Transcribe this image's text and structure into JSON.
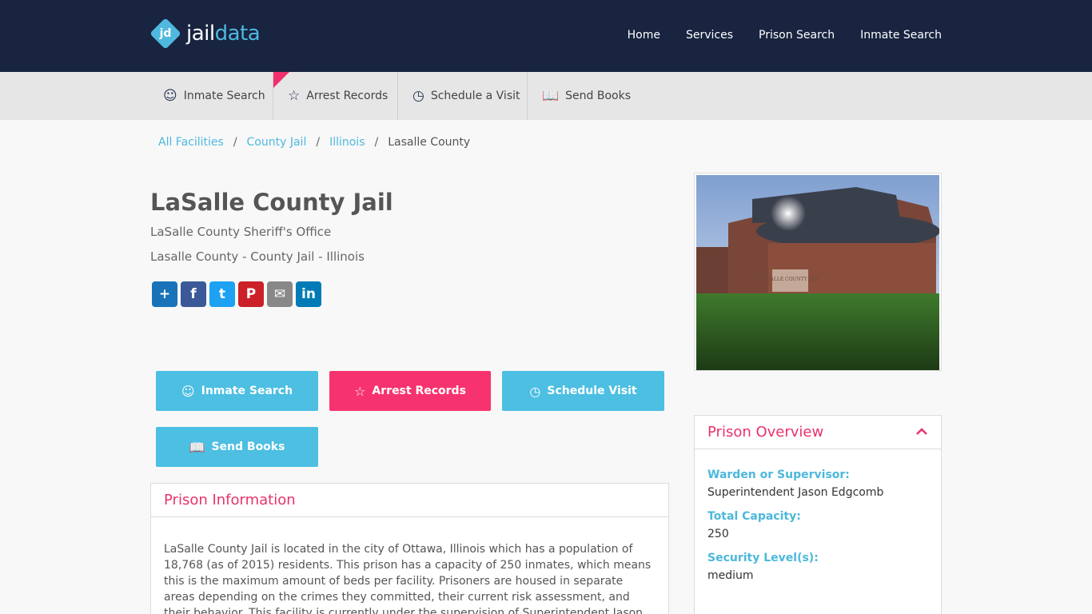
{
  "brand": {
    "mark": "jd",
    "name_part1": "jail",
    "name_part2": "data"
  },
  "topnav": [
    {
      "label": "Home"
    },
    {
      "label": "Services"
    },
    {
      "label": "Prison Search"
    },
    {
      "label": "Inmate Search"
    }
  ],
  "subnav": [
    {
      "label": "Inmate Search",
      "icon": "users-search-icon"
    },
    {
      "label": "Arrest Records",
      "icon": "star-badge-icon"
    },
    {
      "label": "Schedule a Visit",
      "icon": "clock-check-icon"
    },
    {
      "label": "Send Books",
      "icon": "open-book-icon"
    }
  ],
  "breadcrumb": [
    {
      "label": "All Facilities"
    },
    {
      "label": "County Jail"
    },
    {
      "label": "Illinois"
    },
    {
      "label": "Lasalle County"
    }
  ],
  "page": {
    "title": "LaSalle County Jail",
    "subtitle": "LaSalle County Sheriff's Office",
    "location": "Lasalle County - County Jail - Illinois"
  },
  "share": [
    {
      "label": "+",
      "color": "#1a73b8",
      "icon": "share-plus-icon"
    },
    {
      "label": "f",
      "color": "#3b5998",
      "icon": "facebook-icon"
    },
    {
      "label": "t",
      "color": "#1da1f2",
      "icon": "twitter-icon"
    },
    {
      "label": "P",
      "color": "#cb2027",
      "icon": "pinterest-icon"
    },
    {
      "label": "✉",
      "color": "#888888",
      "icon": "email-icon"
    },
    {
      "label": "in",
      "color": "#007bb5",
      "icon": "linkedin-icon"
    }
  ],
  "actions": [
    {
      "label": "Inmate Search",
      "icon": "users-search-icon"
    },
    {
      "label": "Arrest Records",
      "icon": "star-badge-icon"
    },
    {
      "label": "Schedule Visit",
      "icon": "clock-check-icon"
    },
    {
      "label": "Send Books",
      "icon": "open-book-icon"
    }
  ],
  "prison_info": {
    "heading": "Prison Information",
    "text": "LaSalle County Jail is located in the city of Ottawa, Illinois which has a population of 18,768 (as of 2015) residents. This prison has a capacity of 250 inmates, which means this is the maximum amount of beds per facility. Prisoners are housed in separate areas depending on the crimes they committed, their current risk assessment, and their behavior. This facility is currently under the supervision of Superintendent Jason Edgcomb and houses male and"
  },
  "overview": {
    "heading": "Prison Overview",
    "fields": [
      {
        "label": "Warden or Supervisor:",
        "value": "Superintendent Jason Edgcomb"
      },
      {
        "label": "Total Capacity:",
        "value": "250"
      },
      {
        "label": "Security Level(s):",
        "value": "medium"
      }
    ]
  },
  "photo": {
    "sign_text": "LASALLE COUNTY JAIL"
  },
  "colors": {
    "navy": "#182440",
    "accent_blue": "#4cbfe2",
    "accent_pink": "#f7336f"
  }
}
